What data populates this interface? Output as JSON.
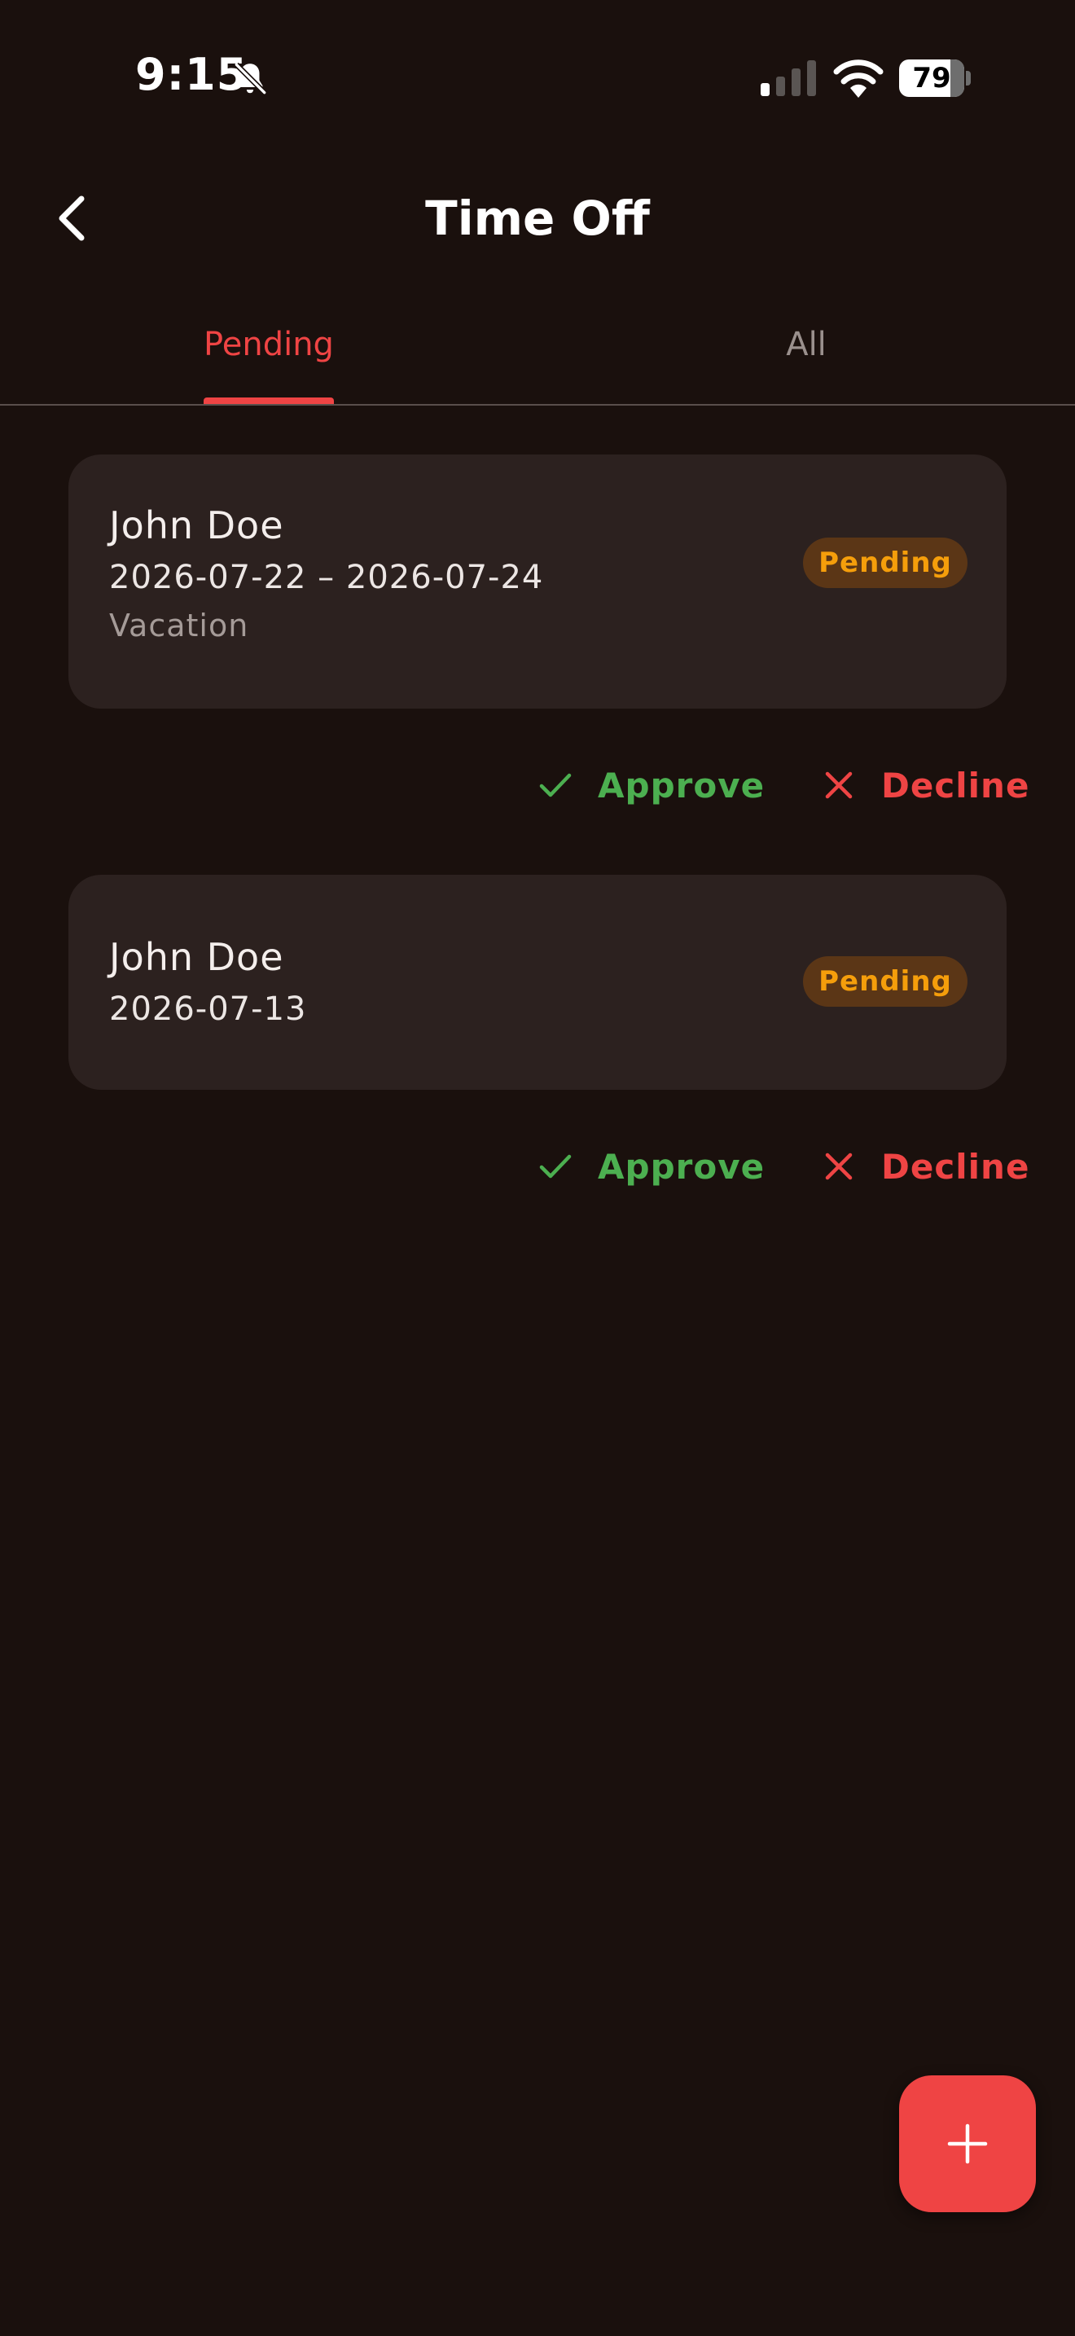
{
  "status_bar": {
    "time": "9:15",
    "battery_level": "79",
    "battery_fraction": 0.79,
    "icons": [
      "bell-off-icon",
      "signal-icon",
      "wifi-icon",
      "battery-icon"
    ]
  },
  "header": {
    "back_icon": "chevron-left-icon",
    "title": "Time Off"
  },
  "tabs": [
    {
      "label": "Pending",
      "active": true
    },
    {
      "label": "All",
      "active": false
    }
  ],
  "requests": [
    {
      "name": "John Doe",
      "dates": "2026-07-22 – 2026-07-24",
      "type": "Vacation",
      "status": "Pending",
      "approve_label": "Approve",
      "decline_label": "Decline"
    },
    {
      "name": "John Doe",
      "dates": "2026-07-13",
      "status": "Pending",
      "approve_label": "Approve",
      "decline_label": "Decline"
    }
  ],
  "fab": {
    "icon": "plus-icon"
  },
  "colors": {
    "background": "#1a100d",
    "card": "#2c211f",
    "accent": "#ef4444",
    "approve": "#4caf50",
    "pending_text": "#f59e0b",
    "pending_badge": "#5b3616"
  }
}
